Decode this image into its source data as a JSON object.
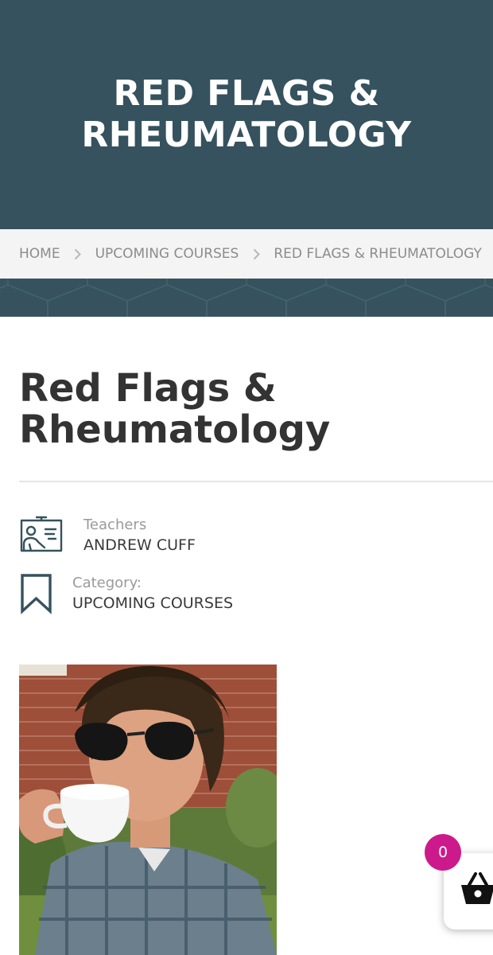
{
  "colors": {
    "hero_background": "#35525e",
    "breadcrumb_background": "#f4f4f4",
    "cart_badge": "#cc1a8c",
    "icon_stroke": "#35525e"
  },
  "hero": {
    "title": "RED FLAGS & RHEUMATOLOGY"
  },
  "breadcrumb": {
    "items": [
      "HOME",
      "UPCOMING COURSES",
      "RED FLAGS & RHEUMATOLOGY"
    ],
    "separator_icon": "chevron-right-icon"
  },
  "course": {
    "title": "Red Flags & Rheumatology",
    "teacher": {
      "icon": "teacher-presentation-icon",
      "label": "Teachers",
      "value": "ANDREW CUFF"
    },
    "category": {
      "icon": "bookmark-icon",
      "label": "Category:",
      "value": "UPCOMING COURSES"
    },
    "image": {
      "description_icon": "teacher-photo"
    }
  },
  "cart": {
    "count": "0",
    "icon": "shopping-basket-icon"
  }
}
